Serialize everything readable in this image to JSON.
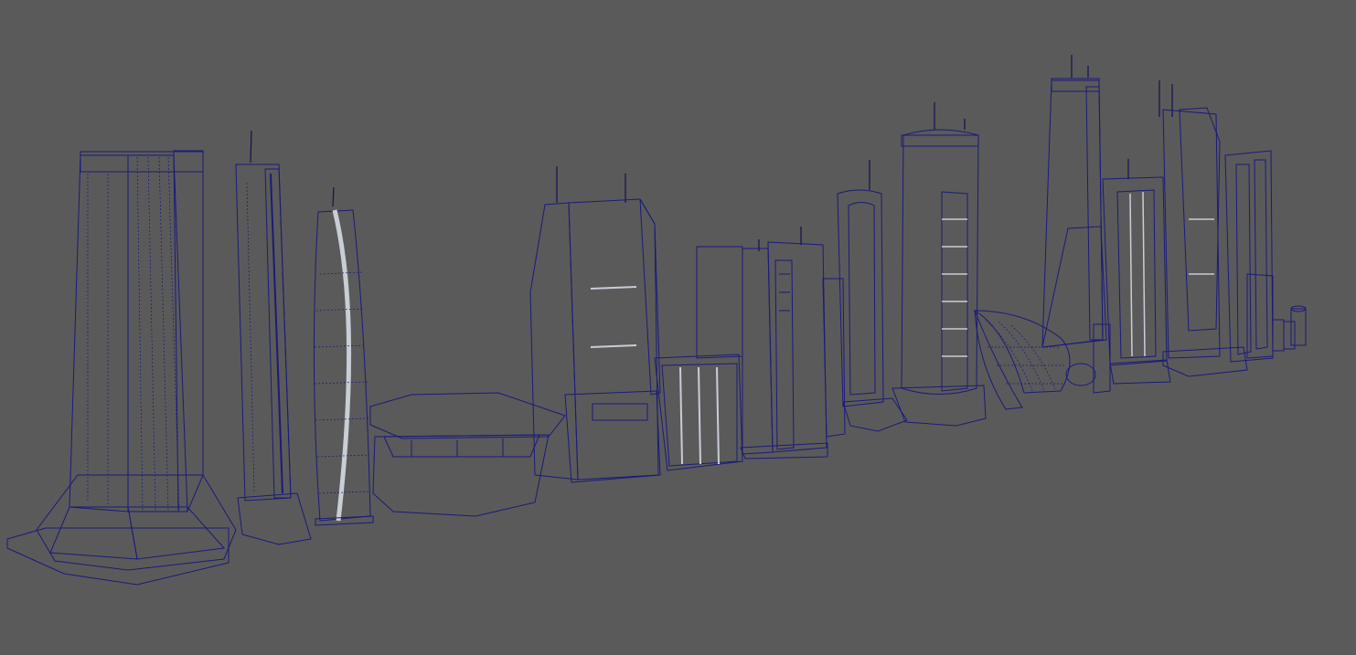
{
  "viewport": {
    "background": "#5a5a5a",
    "wireframe_color": "#1b1b7a",
    "shaded_wireframe": true
  },
  "materials": {
    "concrete_tan": "#8a7d62",
    "concrete_tan_light": "#a39575",
    "glass_dark": "#2e4a50",
    "glass_teal": "#3f7c80",
    "metal_light": "#c9cdd6",
    "metal_grey": "#8c8f96",
    "base_grey": "#7b7b7b",
    "shadow_black": "#121212"
  },
  "scene": {
    "object_count": 15,
    "objects": [
      "tower-01-stepped-base",
      "tower-02-tall-slim",
      "tower-03-twisted-glass",
      "building-04-low-pavilion",
      "tower-05-angled-glass",
      "building-06-glass-cube",
      "tower-07-cluster",
      "tower-08-slim-arch",
      "tower-09-cylinder-core",
      "structure-10-dome-shell",
      "tower-11-tapered",
      "tower-12-white-slab",
      "tower-13-spire-glass",
      "tower-14-cluster-back",
      "props-15-cylinders"
    ]
  }
}
